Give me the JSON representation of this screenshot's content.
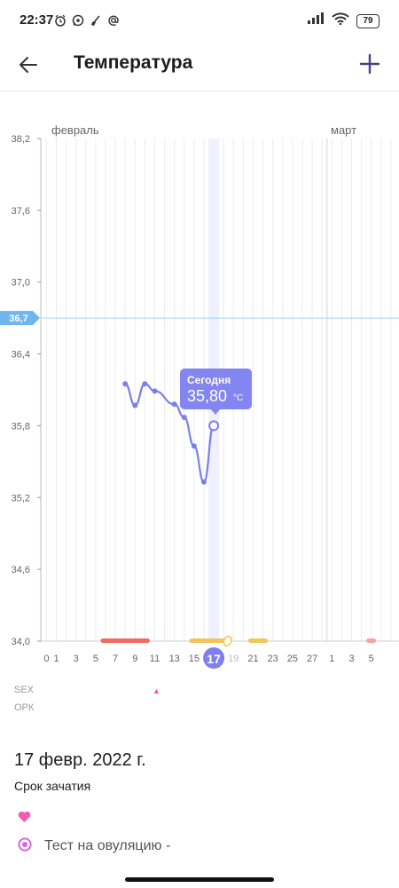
{
  "status_bar": {
    "time": "22:37",
    "left_icons": [
      "alarm-clock-icon",
      "whatsapp-icon",
      "broom-icon",
      "at-sign-icon"
    ],
    "battery": "79"
  },
  "header": {
    "title": "Температура",
    "back_icon": "arrow-left-icon",
    "add_icon": "plus-icon"
  },
  "chart_data": {
    "type": "line",
    "x_label": "",
    "y_label": "",
    "month_labels": [
      {
        "label": "февраль",
        "day_index": 0
      },
      {
        "label": "март",
        "day_index": 28
      }
    ],
    "y_ticks": [
      "38,2",
      "37,6",
      "37,0",
      "36,4",
      "35,8",
      "35,2",
      "34,6",
      "34,0"
    ],
    "ylim": [
      34.0,
      38.2
    ],
    "baseline": {
      "value": 36.7,
      "label": "36,7"
    },
    "x_tick_labels": [
      {
        "day": "0",
        "index": -1
      },
      {
        "day": "1",
        "index": 0
      },
      {
        "day": "3",
        "index": 2
      },
      {
        "day": "5",
        "index": 4
      },
      {
        "day": "7",
        "index": 6
      },
      {
        "day": "9",
        "index": 8
      },
      {
        "day": "11",
        "index": 10
      },
      {
        "day": "13",
        "index": 12
      },
      {
        "day": "15",
        "index": 14
      },
      {
        "day": "17",
        "index": 16,
        "selected": true
      },
      {
        "day": "19",
        "index": 18,
        "future": true
      },
      {
        "day": "21",
        "index": 20
      },
      {
        "day": "23",
        "index": 22
      },
      {
        "day": "25",
        "index": 24
      },
      {
        "day": "27",
        "index": 26
      },
      {
        "day": "1",
        "index": 28
      },
      {
        "day": "3",
        "index": 30
      },
      {
        "day": "5",
        "index": 32
      }
    ],
    "series": [
      {
        "name": "",
        "color": "#7b7ef0",
        "points": [
          {
            "day": 8,
            "value": 36.15
          },
          {
            "day": 9,
            "value": 35.97
          },
          {
            "day": 10,
            "value": 36.15
          },
          {
            "day": 11,
            "value": 36.09
          },
          {
            "day": 13,
            "value": 35.98
          },
          {
            "day": 14,
            "value": 35.87
          },
          {
            "day": 15,
            "value": 35.63
          },
          {
            "day": 16,
            "value": 35.33
          },
          {
            "day": 17,
            "value": 35.8
          }
        ]
      }
    ],
    "period_bars": [
      {
        "type": "menstruation",
        "color": "#ef6b5e",
        "start": 6,
        "end": 11
      },
      {
        "type": "fertile",
        "color": "#f3c45a",
        "start": 15,
        "end": 19
      },
      {
        "type": "fertile",
        "color": "#f3c45a",
        "start": 21,
        "end": 23
      },
      {
        "type": "menstruation-next",
        "color": "#f4a5a3",
        "start": 33,
        "end": 34
      }
    ],
    "ovulation_day": 19,
    "selected_day": 17
  },
  "tooltip": {
    "label": "Сегодня",
    "value": "35,80",
    "unit": "°C"
  },
  "rows": {
    "sex_label": "SEX",
    "opk_label": "ОРК"
  },
  "detail": {
    "date": "17 февр. 2022 г.",
    "status": "Срок зачатия",
    "ovulation_test_label": "Тест на овуляцию -",
    "heart_color": "#f25bb1",
    "ovulation_icon_color": "#d964ea"
  }
}
